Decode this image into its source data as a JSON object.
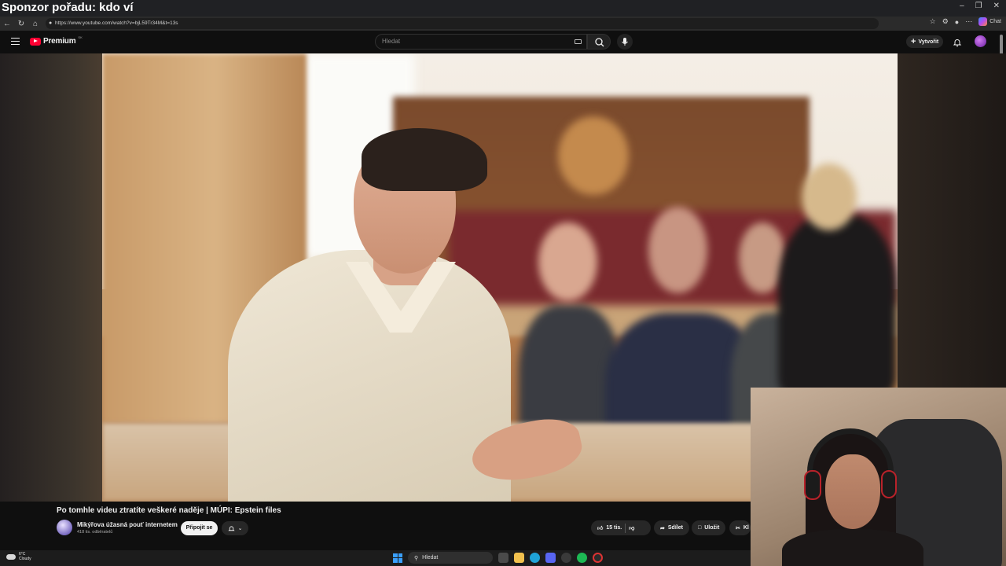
{
  "overlay": {
    "title": "Sponzor pořadu: kdo ví"
  },
  "browser": {
    "url": "https://www.youtube.com/watch?v=bjL59Tr34M&t=13s",
    "chat_label": "Chat"
  },
  "youtube": {
    "brand": "Premium",
    "region": "SK",
    "search_placeholder": "Hledat",
    "create_label": "Vytvořit"
  },
  "video": {
    "title": "Po tomhle videu ztratíte veškeré naděje | MÚPI: Epstein files",
    "channel": "Mikýřova úžasná pouť internetem",
    "subscribers": "418 tis. odběratelů",
    "join_label": "Připojit se",
    "likes": "15 tis.",
    "share_label": "Sdílet",
    "save_label": "Uložit",
    "clip_label": "Kl"
  },
  "taskbar": {
    "temperature": "6°C",
    "condition": "Cloudy",
    "search_label": "Hledat"
  },
  "colors": {
    "yt_red": "#ff0033",
    "background": "#0f0f0f",
    "pill": "#272727"
  }
}
